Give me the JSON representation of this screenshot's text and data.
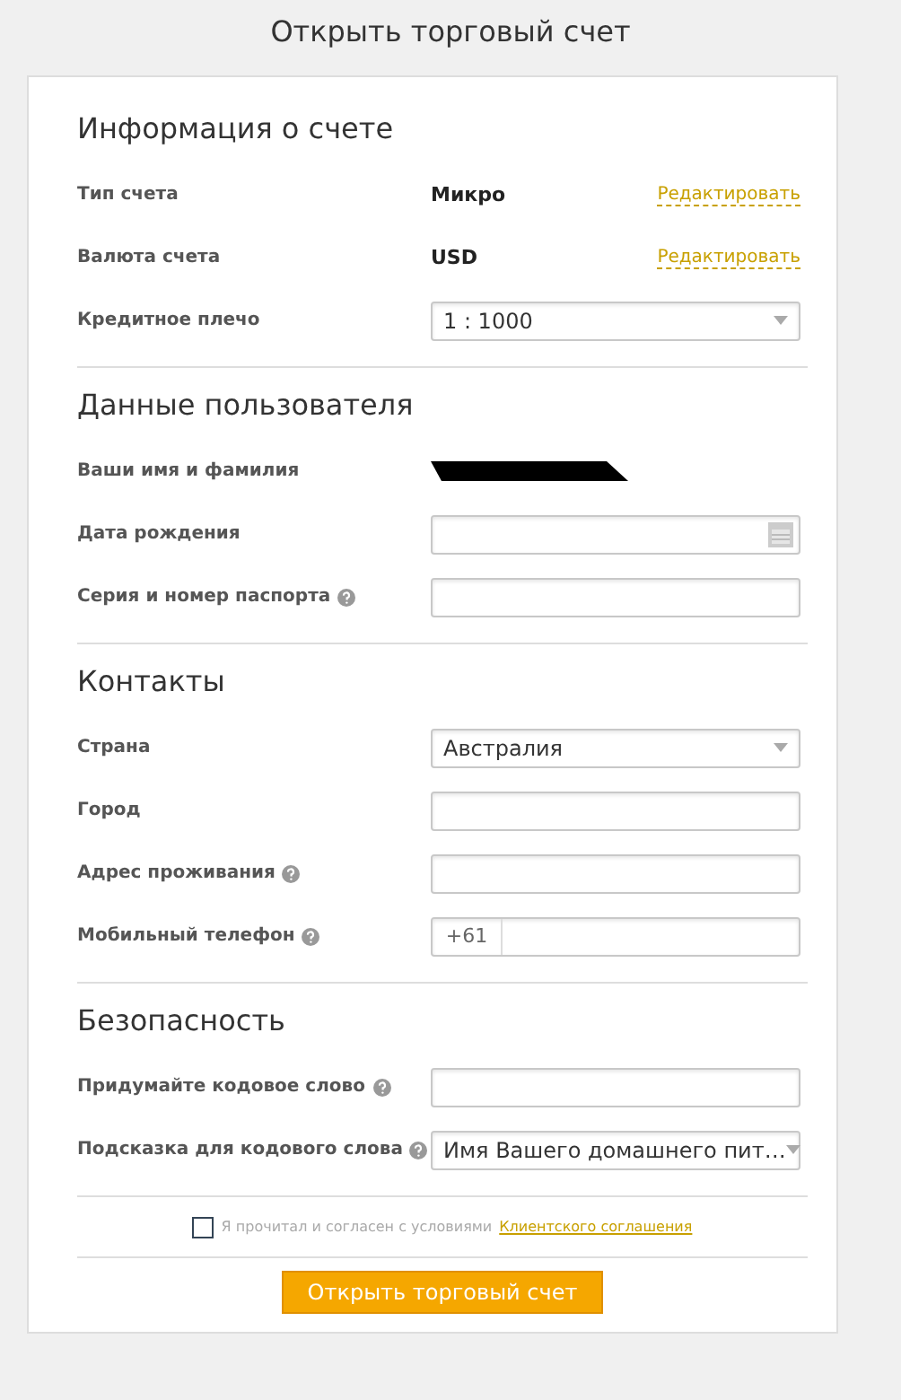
{
  "title": "Открыть торговый счет",
  "sections": [
    {
      "heading": "Информация о счете",
      "rows": [
        {
          "kind": "static",
          "label": "Тип счета",
          "help": false,
          "value": "Микро",
          "link": "Редактировать"
        },
        {
          "kind": "static",
          "label": "Валюта счета",
          "help": false,
          "value": "USD",
          "link": "Редактировать"
        },
        {
          "kind": "select",
          "label": "Кредитное плечо",
          "help": false,
          "value": "1 : 1000"
        }
      ]
    },
    {
      "heading": "Данные пользователя",
      "rows": [
        {
          "kind": "redacted",
          "label": "Ваши имя и фамилия",
          "help": false
        },
        {
          "kind": "date",
          "label": "Дата рождения",
          "help": false
        },
        {
          "kind": "input",
          "label": "Серия и номер паспорта",
          "help": true
        }
      ]
    },
    {
      "heading": "Контакты",
      "rows": [
        {
          "kind": "select",
          "label": "Страна",
          "help": false,
          "value": "Австралия"
        },
        {
          "kind": "input",
          "label": "Город",
          "help": false
        },
        {
          "kind": "input",
          "label": "Адрес проживания",
          "help": true
        },
        {
          "kind": "phone",
          "label": "Мобильный телефон",
          "help": true,
          "prefix": "+61"
        }
      ]
    },
    {
      "heading": "Безопасность",
      "rows": [
        {
          "kind": "input",
          "label": "Придумайте кодовое слово",
          "help": true
        },
        {
          "kind": "select",
          "label": "Подсказка для кодового слова",
          "help": true,
          "value": "Имя Вашего домашнего пит…"
        }
      ]
    }
  ],
  "agreement": {
    "checked": false,
    "text": "Я прочитал и согласен с условиями",
    "link": "Клиентского соглашения"
  },
  "submit": "Открыть торговый счет"
}
